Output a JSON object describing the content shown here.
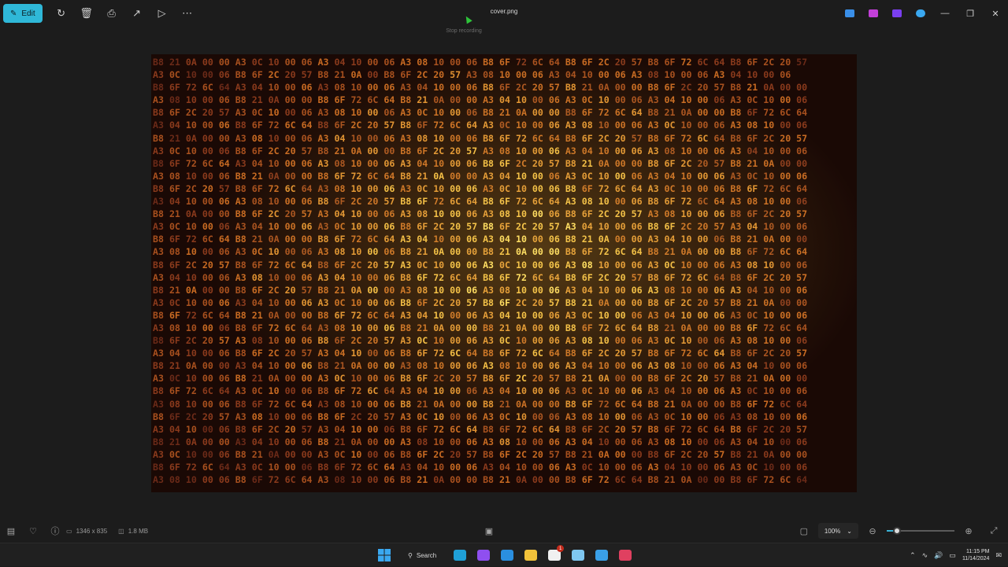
{
  "toolbar": {
    "edit_label": "Edit",
    "title": "cover.png",
    "tooltip": "Stop recording",
    "icons": [
      "rotate-icon",
      "delete-icon",
      "print-icon",
      "share-icon",
      "slideshow-icon",
      "more-icon"
    ],
    "app_icons": [
      "paint-icon",
      "designer-icon",
      "clipchamp-icon",
      "onedrive-icon"
    ]
  },
  "image": {
    "hex_rows": [
      "B8 21 0A 00 00 A3 0C 10 00 06 A3 04 10 00 06 A3 08 10 00 06 B8 6F 72 6C 64 B8 6F 2C 20 57 B8 6F 72 6C 64 B8 6F 2C 20 57",
      "A3 0C 10 00 06 B8 6F 2C 20 57 B8 21 0A 00 B8 6F 2C 20 57 A3 08 10 00 06 A3 04 10 00 06 A3 08 10 00 06 A3 04 10 00 06",
      "B8 6F 72 6C 64 A3 04 10 00 06 A3 08 10 00 06 A3 04 10 00 06 B8 6F 2C 20 57 B8 21 0A 00 00 B8 6F 2C 20 57 B8 21 0A 00 00",
      "A3 08 10 00 06 B8 21 0A 00 00 B8 6F 72 6C 64 B8 21 0A 00 00 A3 04 10 00 06 A3 0C 10 00 06 A3 04 10 00 06 A3 0C 10 00 06",
      "B8 6F 2C 20 57 A3 0C 10 00 06 A3 08 10 00 06 A3 0C 10 00 06 B8 21 0A 00 00 B8 6F 72 6C 64 B8 21 0A 00 00 B8 6F 72 6C 64",
      "A3 04 10 00 06 B8 6F 72 6C 64 B8 6F 2C 20 57 B8 6F 72 6C 64 A3 0C 10 00 06 A3 08 10 00 06 A3 0C 10 00 06 A3 08 10 00 06",
      "B8 21 0A 00 00 A3 08 10 00 06 A3 04 10 00 06 A3 08 10 00 06 B8 6F 72 6C 64 B8 6F 2C 20 57 B8 6F 72 6C 64 B8 6F 2C 20 57",
      "A3 0C 10 00 06 B8 6F 2C 20 57 B8 21 0A 00 00 B8 6F 2C 20 57 A3 08 10 00 06 A3 04 10 00 06 A3 08 10 00 06 A3 04 10 00 06",
      "B8 6F 72 6C 64 A3 04 10 00 06 A3 08 10 00 06 A3 04 10 00 06 B8 6F 2C 20 57 B8 21 0A 00 00 B8 6F 2C 20 57 B8 21 0A 00 00",
      "A3 08 10 00 06 B8 21 0A 00 00 B8 6F 72 6C 64 B8 21 0A 00 00 A3 04 10 00 06 A3 0C 10 00 06 A3 04 10 00 06 A3 0C 10 00 06",
      "B8 6F 2C 20 57 B8 6F 72 6C 64 A3 08 10 00 06 A3 0C 10 00 06 A3 0C 10 00 06 B8 6F 72 6C 64 A3 0C 10 00 06 B8 6F 72 6C 64",
      "A3 04 10 00 06 A3 08 10 00 06 B8 6F 2C 20 57 B8 6F 72 6C 64 B8 6F 72 6C 64 A3 08 10 00 06 B8 6F 72 6C 64 A3 08 10 00 06",
      "B8 21 0A 00 00 B8 6F 2C 20 57 A3 04 10 00 06 A3 08 10 00 06 A3 08 10 00 06 B8 6F 2C 20 57 A3 08 10 00 06 B8 6F 2C 20 57",
      "A3 0C 10 00 06 A3 04 10 00 06 A3 0C 10 00 06 B8 6F 2C 20 57 B8 6F 2C 20 57 A3 04 10 00 06 B8 6F 2C 20 57 A3 04 10 00 06",
      "B8 6F 72 6C 64 B8 21 0A 00 00 B8 6F 72 6C 64 A3 04 10 00 06 A3 04 10 00 06 B8 21 0A 00 00 A3 04 10 00 06 B8 21 0A 00 00",
      "A3 08 10 00 06 A3 0C 10 00 06 A3 08 10 00 06 B8 21 0A 00 00 B8 21 0A 00 00 B8 6F 72 6C 64 B8 21 0A 00 00 B8 6F 72 6C 64",
      "B8 6F 2C 20 57 B8 6F 72 6C 64 B8 6F 2C 20 57 A3 0C 10 00 06 A3 0C 10 00 06 A3 08 10 00 06 A3 0C 10 00 06 A3 08 10 00 06",
      "A3 04 10 00 06 A3 08 10 00 06 A3 04 10 00 06 B8 6F 72 6C 64 B8 6F 72 6C 64 B8 6F 2C 20 57 B8 6F 72 6C 64 B8 6F 2C 20 57",
      "B8 21 0A 00 00 B8 6F 2C 20 57 B8 21 0A 00 00 A3 08 10 00 06 A3 08 10 00 06 A3 04 10 00 06 A3 08 10 00 06 A3 04 10 00 06",
      "A3 0C 10 00 06 A3 04 10 00 06 A3 0C 10 00 06 B8 6F 2C 20 57 B8 6F 2C 20 57 B8 21 0A 00 00 B8 6F 2C 20 57 B8 21 0A 00 00",
      "B8 6F 72 6C 64 B8 21 0A 00 00 B8 6F 72 6C 64 A3 04 10 00 06 A3 04 10 00 06 A3 0C 10 00 06 A3 04 10 00 06 A3 0C 10 00 06",
      "A3 08 10 00 06 B8 6F 72 6C 64 A3 08 10 00 06 B8 21 0A 00 00 B8 21 0A 00 00 B8 6F 72 6C 64 B8 21 0A 00 00 B8 6F 72 6C 64",
      "B8 6F 2C 20 57 A3 08 10 00 06 B8 6F 2C 20 57 A3 0C 10 00 06 A3 0C 10 00 06 A3 08 10 00 06 A3 0C 10 00 06 A3 08 10 00 06",
      "A3 04 10 00 06 B8 6F 2C 20 57 A3 04 10 00 06 B8 6F 72 6C 64 B8 6F 72 6C 64 B8 6F 2C 20 57 B8 6F 72 6C 64 B8 6F 2C 20 57",
      "B8 21 0A 00 00 A3 04 10 00 06 B8 21 0A 00 00 A3 08 10 00 06 A3 08 10 00 06 A3 04 10 00 06 A3 08 10 00 06 A3 04 10 00 06",
      "A3 0C 10 00 06 B8 21 0A 00 00 A3 0C 10 00 06 B8 6F 2C 20 57 B8 6F 2C 20 57 B8 21 0A 00 00 B8 6F 2C 20 57 B8 21 0A 00 00",
      "B8 6F 72 6C 64 A3 0C 10 00 06 B8 6F 72 6C 64 A3 04 10 00 06 A3 04 10 00 06 A3 0C 10 00 06 A3 04 10 00 06 A3 0C 10 00 06",
      "A3 08 10 00 06 B8 6F 72 6C 64 A3 08 10 00 06 B8 21 0A 00 00 B8 21 0A 00 00 B8 6F 72 6C 64 B8 21 0A 00 00 B8 6F 72 6C 64",
      "B8 6F 2C 20 57 A3 08 10 00 06 B8 6F 2C 20 57 A3 0C 10 00 06 A3 0C 10 00 06 A3 08 10 00 06 A3 0C 10 00 06 A3 08 10 00 06",
      "A3 04 10 00 06 B8 6F 2C 20 57 A3 04 10 00 06 B8 6F 72 6C 64 B8 6F 72 6C 64 B8 6F 2C 20 57 B8 6F 72 6C 64 B8 6F 2C 20 57",
      "B8 21 0A 00 00 A3 04 10 00 06 B8 21 0A 00 00 A3 08 10 00 06 A3 08 10 00 06 A3 04 10 00 06 A3 08 10 00 06 A3 04 10 00 06",
      "A3 0C 10 00 06 B8 21 0A 00 00 A3 0C 10 00 06 B8 6F 2C 20 57 B8 6F 2C 20 57 B8 21 0A 00 00 B8 6F 2C 20 57 B8 21 0A 00 00",
      "B8 6F 72 6C 64 A3 0C 10 00 06 B8 6F 72 6C 64 A3 04 10 00 06 A3 04 10 00 06 A3 0C 10 00 06 A3 04 10 00 06 A3 0C 10 00 06",
      "A3 08 10 00 06 B8 6F 72 6C 64 A3 08 10 00 06 B8 21 0A 00 00 B8 21 0A 00 00 B8 6F 72 6C 64 B8 21 0A 00 00 B8 6F 72 6C 64"
    ],
    "colors": [
      "#6b2a18",
      "#8a3a1c",
      "#a8501e",
      "#c86a22",
      "#e09030",
      "#f2b840",
      "#ffd75a"
    ]
  },
  "statusbar": {
    "dimensions": "1346 x 835",
    "size": "1.8 MB",
    "zoom": "100%",
    "zoom_fraction": 0.15
  },
  "taskbar": {
    "search_label": "Search",
    "badge": "1",
    "time": "11:15 PM",
    "date": "11/14/2024",
    "apps": [
      {
        "name": "edge-icon",
        "color": "#1fa0d8"
      },
      {
        "name": "messenger-icon",
        "color": "#8f4ff0"
      },
      {
        "name": "vscode-icon",
        "color": "#2a8fe0"
      },
      {
        "name": "file-explorer-icon",
        "color": "#f2c23a"
      },
      {
        "name": "chat-app-icon",
        "color": "#f0f0f0"
      },
      {
        "name": "notepad-icon",
        "color": "#7fc7f0"
      },
      {
        "name": "paint-app-icon",
        "color": "#3aa0e8"
      },
      {
        "name": "snipping-tool-icon",
        "color": "#e04060"
      }
    ]
  }
}
